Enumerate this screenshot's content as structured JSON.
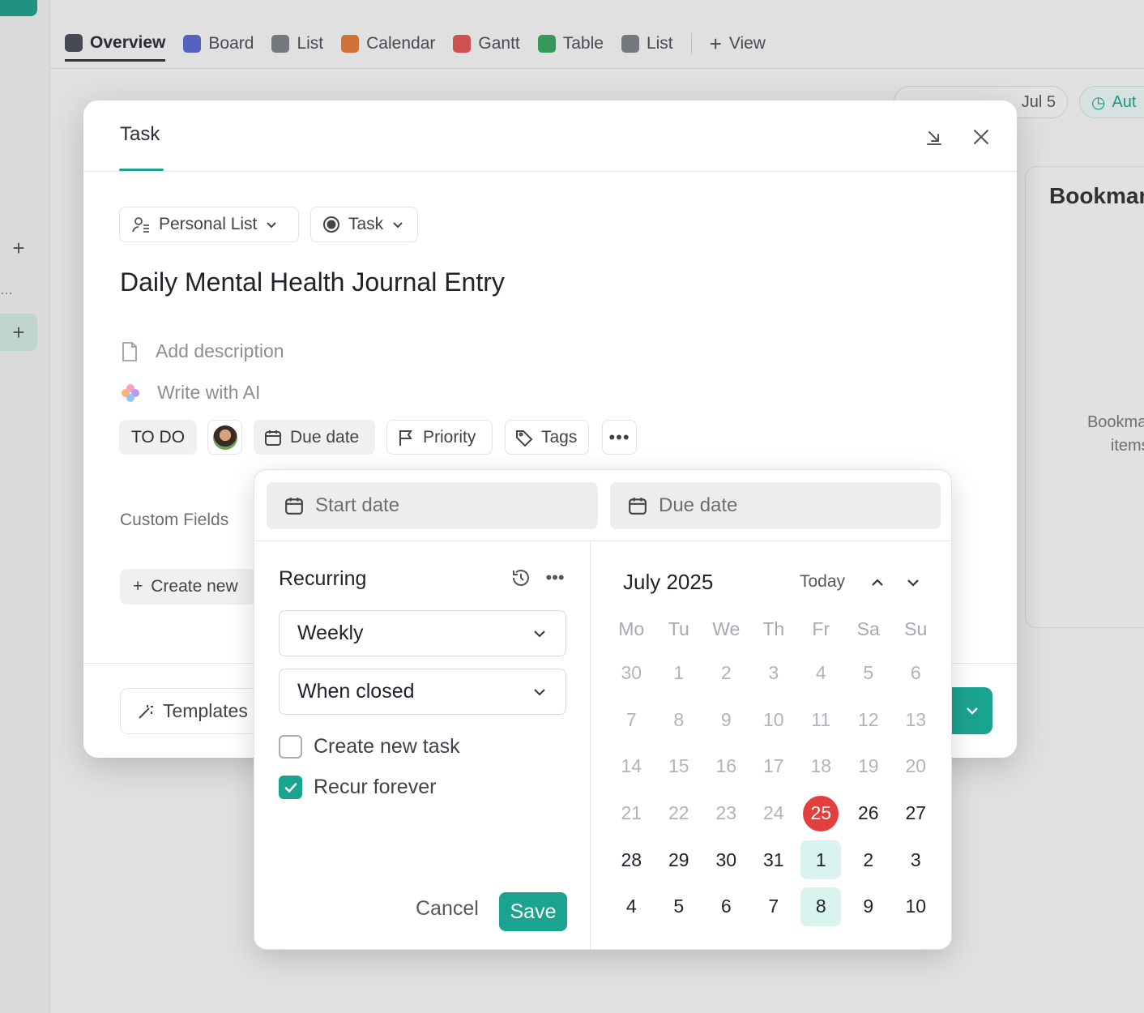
{
  "background": {
    "tabs": [
      {
        "label": "Overview",
        "icon": "info-icon",
        "color": "#4b4f57",
        "active": true
      },
      {
        "label": "Board",
        "icon": "board-icon",
        "color": "#5b6ad0"
      },
      {
        "label": "List",
        "icon": "list-icon",
        "color": "#7d8088"
      },
      {
        "label": "Calendar",
        "icon": "calendar-icon",
        "color": "#e37b3b"
      },
      {
        "label": "Gantt",
        "icon": "gantt-icon",
        "color": "#e05555"
      },
      {
        "label": "Table",
        "icon": "table-icon",
        "color": "#3aa55d"
      },
      {
        "label": "List",
        "icon": "list-icon",
        "color": "#7d8088"
      }
    ],
    "add_view_label": "View",
    "refreshed_label": "Jul 5",
    "auto_label": "Aut",
    "bookmarks_title": "Bookmar",
    "bookmarks_text_1": "Bookmarks",
    "bookmarks_text_2": "items or"
  },
  "modal": {
    "title": "Task",
    "list_selector": "Personal List",
    "type_selector": "Task",
    "task_title": "Daily Mental Health Journal Entry",
    "add_description": "Add description",
    "write_ai": "Write with AI",
    "status": "TO DO",
    "due_date_button": "Due date",
    "priority_button": "Priority",
    "tags_button": "Tags",
    "custom_fields_label": "Custom Fields",
    "create_new_label": "Create new",
    "templates_label": "Templates",
    "accent_color": "#1aa38f"
  },
  "popover": {
    "start_date_placeholder": "Start date",
    "due_date_placeholder": "Due date",
    "recurring_title": "Recurring",
    "frequency": "Weekly",
    "trigger": "When closed",
    "create_new_task_label": "Create new task",
    "create_new_task_checked": false,
    "recur_forever_label": "Recur forever",
    "recur_forever_checked": true,
    "cancel_label": "Cancel",
    "save_label": "Save",
    "month_label": "July 2025",
    "today_label": "Today",
    "weekdays": [
      "Mo",
      "Tu",
      "We",
      "Th",
      "Fr",
      "Sa",
      "Su"
    ],
    "weeks": [
      [
        {
          "d": "30",
          "m": 1
        },
        {
          "d": "1",
          "m": 1
        },
        {
          "d": "2",
          "m": 1
        },
        {
          "d": "3",
          "m": 1
        },
        {
          "d": "4",
          "m": 1
        },
        {
          "d": "5",
          "m": 1
        },
        {
          "d": "6",
          "m": 1
        }
      ],
      [
        {
          "d": "7",
          "m": 1
        },
        {
          "d": "8",
          "m": 1
        },
        {
          "d": "9",
          "m": 1
        },
        {
          "d": "10",
          "m": 1
        },
        {
          "d": "11",
          "m": 1
        },
        {
          "d": "12",
          "m": 1
        },
        {
          "d": "13",
          "m": 1
        }
      ],
      [
        {
          "d": "14",
          "m": 1
        },
        {
          "d": "15",
          "m": 1
        },
        {
          "d": "16",
          "m": 1
        },
        {
          "d": "17",
          "m": 1
        },
        {
          "d": "18",
          "m": 1
        },
        {
          "d": "19",
          "m": 1
        },
        {
          "d": "20",
          "m": 1
        }
      ],
      [
        {
          "d": "21",
          "m": 1
        },
        {
          "d": "22",
          "m": 1
        },
        {
          "d": "23",
          "m": 1
        },
        {
          "d": "24",
          "m": 1
        },
        {
          "d": "25",
          "t": 1
        },
        {
          "d": "26"
        },
        {
          "d": "27"
        }
      ],
      [
        {
          "d": "28"
        },
        {
          "d": "29"
        },
        {
          "d": "30"
        },
        {
          "d": "31"
        },
        {
          "d": "1",
          "s": 1
        },
        {
          "d": "2"
        },
        {
          "d": "3"
        }
      ],
      [
        {
          "d": "4"
        },
        {
          "d": "5"
        },
        {
          "d": "6"
        },
        {
          "d": "7"
        },
        {
          "d": "8",
          "s": 1
        },
        {
          "d": "9"
        },
        {
          "d": "10"
        }
      ]
    ]
  }
}
